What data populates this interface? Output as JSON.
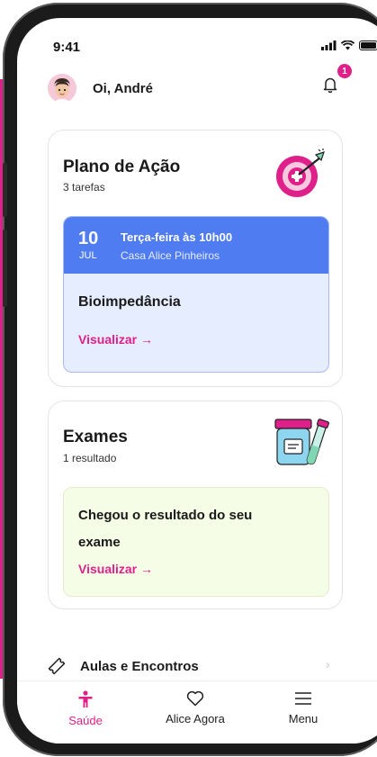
{
  "status_bar": {
    "time": "9:41"
  },
  "header": {
    "greeting": "Oi, André",
    "notification_count": "1"
  },
  "plan_card": {
    "title": "Plano de Ação",
    "subtitle": "3 tarefas",
    "appointment": {
      "day": "10",
      "month": "JUL",
      "when": "Terça-feira às 10h00",
      "where": "Casa Alice Pinheiros",
      "name": "Bioimpedância",
      "link_label": "Visualizar →"
    }
  },
  "exams_card": {
    "title": "Exames",
    "subtitle": "1 resultado",
    "result_text": "Chegou o resultado do seu exame",
    "link_label": "Visualizar →"
  },
  "list_item": {
    "label": "Aulas e Encontros"
  },
  "tabbar": {
    "tabs": [
      {
        "label": "Saúde",
        "active": true
      },
      {
        "label": "Alice Agora",
        "active": false
      },
      {
        "label": "Menu",
        "active": false
      }
    ]
  },
  "colors": {
    "accent": "#e0208a",
    "appointment_blue": "#4f7cf0",
    "result_green": "#f6fde6"
  },
  "icons": [
    "target-icon",
    "exam-tube-icon",
    "bell-icon",
    "ticket-icon",
    "person-icon",
    "heart-icon",
    "menu-icon"
  ]
}
